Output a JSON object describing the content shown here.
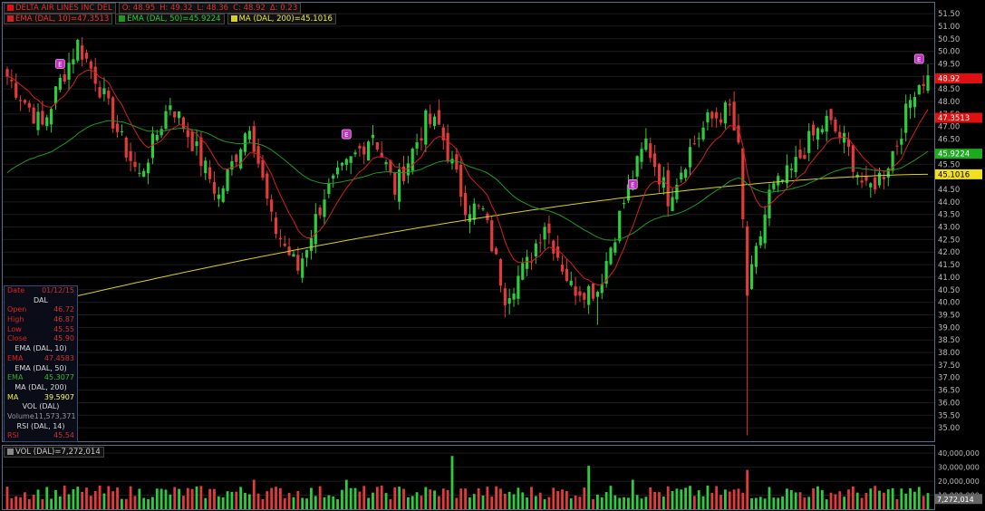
{
  "legend": {
    "symbol": "DELTA AIR LINES INC DEL",
    "open": "O: 48.95",
    "high": "H: 49.32",
    "low": "L: 48.36",
    "close": "C: 48.92",
    "change": "Δ: 0.23",
    "ema10": "EMA (DAL, 10)=47.3513",
    "ema50": "EMA (DAL, 50)=45.9224",
    "ma200": "MA (DAL, 200)=45.1016"
  },
  "vol_legend": "VOL (DAL)=7,272,014",
  "info": {
    "date_label": "Date",
    "date_value": "01/12/15",
    "symbol": "DAL",
    "open_label": "Open",
    "open_value": "46.72",
    "high_label": "High",
    "high_value": "46.87",
    "low_label": "Low",
    "low_value": "45.55",
    "close_label": "Close",
    "close_value": "45.90",
    "ema10_head": "EMA (DAL, 10)",
    "ema10_label": "EMA",
    "ema10_value": "47.4583",
    "ema50_head": "EMA (DAL, 50)",
    "ema50_label": "EMA",
    "ema50_value": "45.3077",
    "ma200_head": "MA (DAL, 200)",
    "ma200_label": "MA",
    "ma200_value": "39.5907",
    "vol_head": "VOL (DAL)",
    "volume_label": "Volume",
    "volume_value": "11,573,371",
    "rsi_head": "RSI (DAL, 14)",
    "rsi_label": "RSI",
    "rsi_value": "45.54"
  },
  "colors": {
    "up": "#2ecc40",
    "down": "#e23b3b",
    "ema10": "#d42020",
    "ema50": "#1f9a1f",
    "ma200": "#d8d020",
    "grid": "#1c1c1c",
    "earnings": "#c030c0"
  },
  "chart_data": [
    {
      "type": "candlestick",
      "title": "DELTA AIR LINES INC DEL",
      "ylim": [
        34.5,
        51.9
      ],
      "yticks": [
        "51.50",
        "51.00",
        "50.50",
        "50.00",
        "49.50",
        "49.00",
        "48.50",
        "48.00",
        "47.50",
        "47.00",
        "46.50",
        "46.00",
        "45.50",
        "45.00",
        "44.50",
        "44.00",
        "43.50",
        "43.00",
        "42.50",
        "42.00",
        "41.50",
        "41.00",
        "40.50",
        "40.00",
        "39.50",
        "39.00",
        "38.50",
        "38.00",
        "37.50",
        "37.00",
        "36.50",
        "36.00",
        "35.50",
        "35.00"
      ],
      "last_price_tags": [
        {
          "label": "48.92",
          "value": 48.92,
          "color": "#e01010"
        },
        {
          "label": "47.3513",
          "value": 47.35,
          "color": "#e01010"
        },
        {
          "label": "45.9224",
          "value": 45.92,
          "color": "#1eaa1e"
        },
        {
          "label": "45.1016",
          "value": 45.1,
          "color": "#f0e020"
        }
      ],
      "earnings_markers": [
        {
          "label": "E",
          "index": 12,
          "value": 49.5
        },
        {
          "label": "E",
          "index": 77,
          "value": 46.7
        },
        {
          "label": "E",
          "index": 142,
          "value": 44.7
        },
        {
          "label": "E",
          "index": 207,
          "value": 49.7
        }
      ],
      "ma200_anchor": {
        "start": 39.6,
        "end": 45.1
      },
      "ema10_last": 47.35,
      "ema50_last": 45.92,
      "keypoints": [
        [
          0,
          49.0
        ],
        [
          8,
          47.0
        ],
        [
          12,
          48.8
        ],
        [
          16,
          50.3
        ],
        [
          20,
          49.0
        ],
        [
          26,
          46.4
        ],
        [
          30,
          45.0
        ],
        [
          37,
          48.0
        ],
        [
          42,
          46.4
        ],
        [
          48,
          44.2
        ],
        [
          55,
          47.2
        ],
        [
          60,
          43.2
        ],
        [
          66,
          41.3
        ],
        [
          72,
          44.3
        ],
        [
          78,
          45.6
        ],
        [
          83,
          46.8
        ],
        [
          88,
          44.5
        ],
        [
          95,
          47.2
        ],
        [
          98,
          47.0
        ],
        [
          104,
          43.9
        ],
        [
          108,
          43.6
        ],
        [
          113,
          40.3
        ],
        [
          118,
          41.5
        ],
        [
          122,
          43.2
        ],
        [
          128,
          40.6
        ],
        [
          134,
          40.5
        ],
        [
          140,
          44.0
        ],
        [
          145,
          46.4
        ],
        [
          150,
          44.2
        ],
        [
          155,
          46.1
        ],
        [
          159,
          47.2
        ],
        [
          164,
          47.7
        ],
        [
          166,
          46.0
        ],
        [
          168,
          40.3
        ],
        [
          173,
          44.3
        ],
        [
          178,
          45.2
        ],
        [
          182,
          46.4
        ],
        [
          186,
          47.2
        ],
        [
          190,
          46.4
        ],
        [
          195,
          44.4
        ],
        [
          199,
          45.2
        ],
        [
          202,
          46.4
        ],
        [
          206,
          48.6
        ],
        [
          208,
          48.9
        ]
      ],
      "spikes": [
        {
          "index": 168,
          "low": 34.7
        },
        {
          "index": 134,
          "low": 39.1
        },
        {
          "index": 113,
          "low": 39.4
        }
      ]
    },
    {
      "type": "bar",
      "title": "VOL (DAL)",
      "ylim": [
        0,
        44000000
      ],
      "yticks": [
        "40,000,000",
        "30,000,000",
        "20,000,000",
        "10,000,000"
      ],
      "last_value_tag": "7,272,014",
      "peaks": [
        {
          "index": 101,
          "value": 38000000
        },
        {
          "index": 132,
          "value": 31000000
        },
        {
          "index": 168,
          "value": 28000000
        },
        {
          "index": 56,
          "value": 21000000
        },
        {
          "index": 77,
          "value": 21000000
        },
        {
          "index": 142,
          "value": 21000000
        }
      ],
      "base_range": [
        7000000,
        17000000
      ]
    }
  ]
}
